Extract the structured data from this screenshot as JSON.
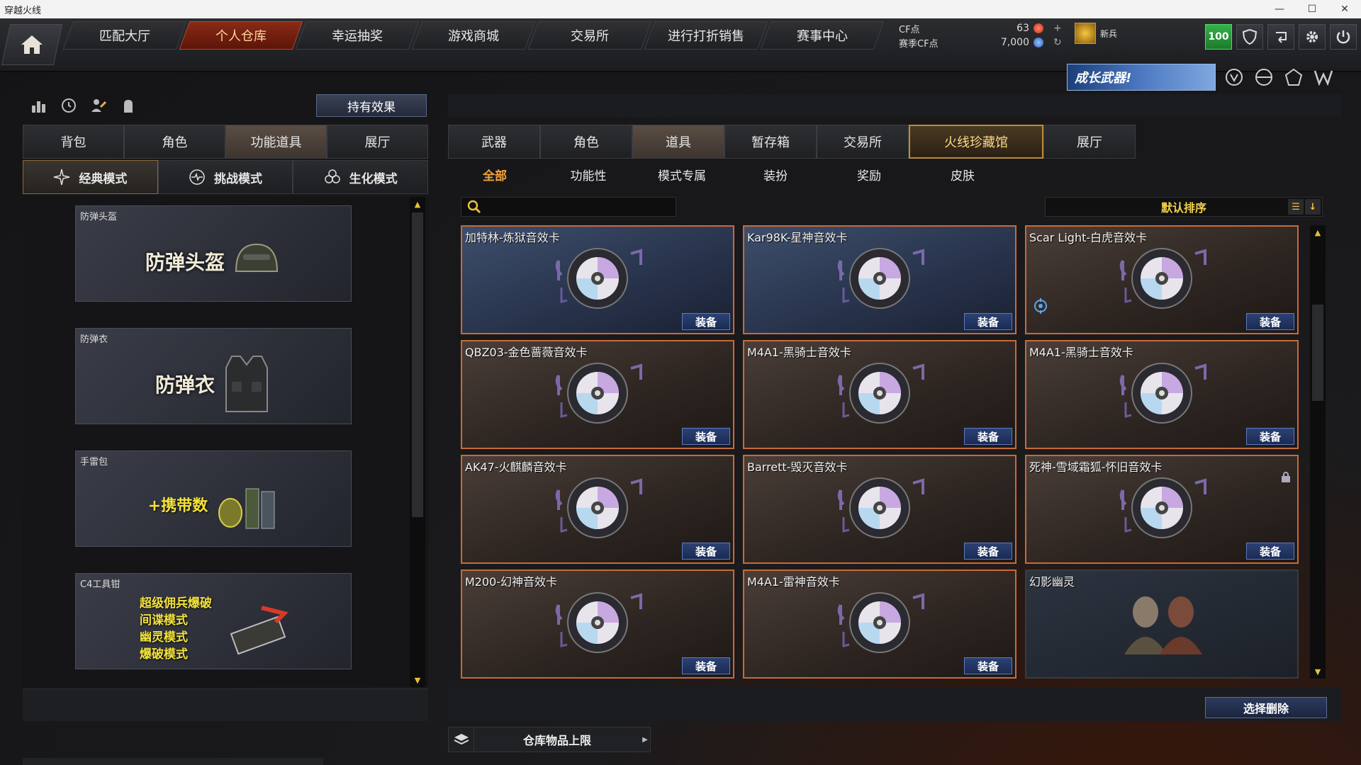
{
  "window": {
    "title": "穿越火线",
    "min": "—",
    "max": "☐",
    "close": "✕"
  },
  "topnav": {
    "tabs": [
      "匹配大厅",
      "个人仓库",
      "幸运抽奖",
      "游戏商城",
      "交易所",
      "进行打折销售",
      "赛事中心"
    ],
    "active_tab": "个人仓库",
    "cf_label": "CF点",
    "cf_value": "63",
    "season_cf_label": "赛季CF点",
    "season_cf_value": "7,000",
    "add": "+",
    "refresh": "↻",
    "rank_name": "新兵",
    "level_badge": "100",
    "promo_text": "成长武器!",
    "colors": {
      "accent_active": "#8a2a17",
      "level_green": "#36b24a",
      "cf_red": "#e23a2a",
      "cf_blue": "#3a7ae0"
    }
  },
  "left": {
    "hold_effect_button": "持有效果",
    "tabs": [
      "背包",
      "角色",
      "功能道具",
      "展厅"
    ],
    "active_tab": "功能道具",
    "modes": [
      {
        "label": "经典模式",
        "icon": "crosshair-star-icon"
      },
      {
        "label": "挑战模式",
        "icon": "heartbeat-icon"
      },
      {
        "label": "生化模式",
        "icon": "biohazard-icon"
      }
    ],
    "active_mode": "经典模式",
    "items": [
      {
        "label": "防弹头盔",
        "art_text": "防弹头盔",
        "icon": "helmet-icon"
      },
      {
        "label": "防弹衣",
        "art_text": "防弹衣",
        "icon": "vest-icon"
      },
      {
        "label": "手雷包",
        "art_text": "+携带数",
        "icon": "grenade-icon"
      },
      {
        "label": "C4工具钳",
        "art_lines": [
          "超级佣兵爆破",
          "间谍模式",
          "幽灵模式",
          "爆破模式"
        ],
        "icon": "c4-tool-icon"
      }
    ]
  },
  "right": {
    "tabs": [
      "武器",
      "角色",
      "道具",
      "暂存箱",
      "交易所",
      "火线珍藏馆",
      "展厅"
    ],
    "active_tab": "道具",
    "highlight_tab": "火线珍藏馆",
    "subtabs": [
      "全部",
      "功能性",
      "模式专属",
      "装扮",
      "奖励",
      "皮肤"
    ],
    "active_subtab": "全部",
    "search_placeholder": "",
    "sort_label": "默认排序",
    "equip_label": "装备",
    "cards": [
      {
        "name": "加特林-炼狱音效卡",
        "style": "blue",
        "equip": true
      },
      {
        "name": "Kar98K-星神音效卡",
        "style": "blue",
        "equip": true
      },
      {
        "name": "Scar Light-白虎音效卡",
        "style": "brown",
        "equip": true,
        "badge": "target-icon"
      },
      {
        "name": "QBZ03-金色蔷薇音效卡",
        "style": "brown",
        "equip": true
      },
      {
        "name": "M4A1-黑骑士音效卡",
        "style": "brown",
        "equip": true
      },
      {
        "name": "M4A1-黑骑士音效卡",
        "style": "brown",
        "equip": true
      },
      {
        "name": "AK47-火麒麟音效卡",
        "style": "brown",
        "equip": true
      },
      {
        "name": "Barrett-毁灭音效卡",
        "style": "brown",
        "equip": true
      },
      {
        "name": "死神-雪域霜狐-怀旧音效卡",
        "style": "brown",
        "equip": true,
        "lock": true
      },
      {
        "name": "M200-幻神音效卡",
        "style": "brown",
        "equip": true
      },
      {
        "name": "M4A1-雷神音效卡",
        "style": "brown",
        "equip": true
      },
      {
        "name": "幻影幽灵",
        "style": "plain",
        "equip": false,
        "art": "ghost-characters-icon"
      }
    ],
    "delete_button": "选择删除",
    "storage_limit": "仓库物品上限"
  }
}
